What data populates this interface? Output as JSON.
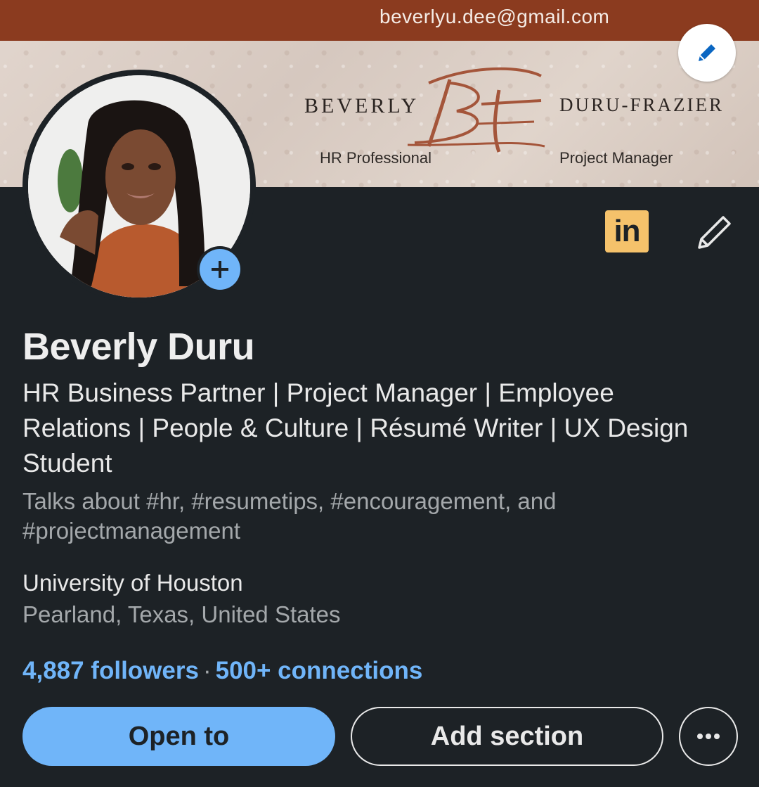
{
  "banner": {
    "email": "beverlyu.dee@gmail.com",
    "brand_first": "BEVERLY",
    "brand_last": "DURU-FRAZIER",
    "role_left": "HR Professional",
    "role_right": "Project Manager",
    "edit_icon": "pencil-icon"
  },
  "profile": {
    "name": "Beverly Duru",
    "headline": "HR Business Partner | Project Manager | Employee Relations | People & Culture | Résumé Writer | UX Design Student",
    "talks_about": "Talks about #hr, #resumetips, #encouragement, and #projectmanagement",
    "education": "University of Houston",
    "location": "Pearland, Texas, United States",
    "followers": "4,887 followers",
    "separator": "·",
    "connections": "500+ connections",
    "linkedin_badge": "in"
  },
  "actions": {
    "open_to": "Open to",
    "add_section": "Add section",
    "more_icon": "more-icon"
  },
  "colors": {
    "background": "#1d2226",
    "accent": "#70b5f9",
    "email_bar": "#8b3b1f",
    "badge": "#f5c26b"
  }
}
